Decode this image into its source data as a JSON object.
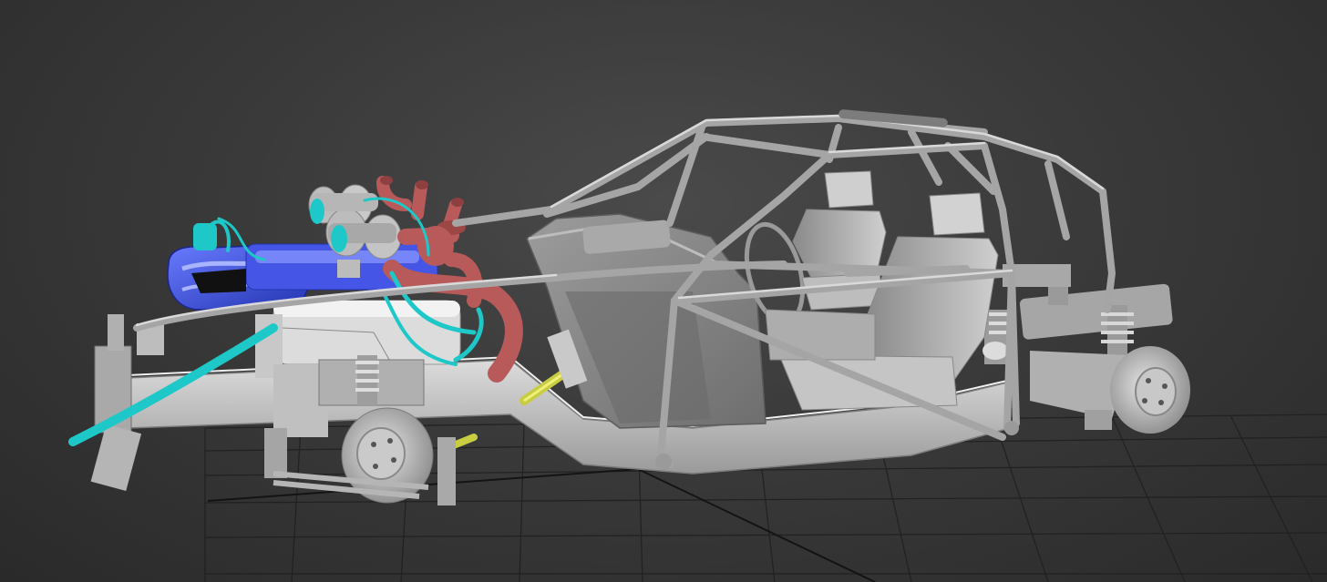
{
  "viewport": {
    "label": "",
    "background": "#3c3c3c",
    "grid_color": "#1e1e1e",
    "model_colors": {
      "chassis": "#b8b8b8",
      "engine_block": "#3a4fd6",
      "hoses_cyan": "#1ec8c8",
      "intake_red": "#b85a5a",
      "driveshaft": "#c8cc40"
    },
    "icons": [
      "roll-cage-model",
      "engine-model",
      "seat-model",
      "wheel-hub-model",
      "viewport-grid"
    ]
  }
}
